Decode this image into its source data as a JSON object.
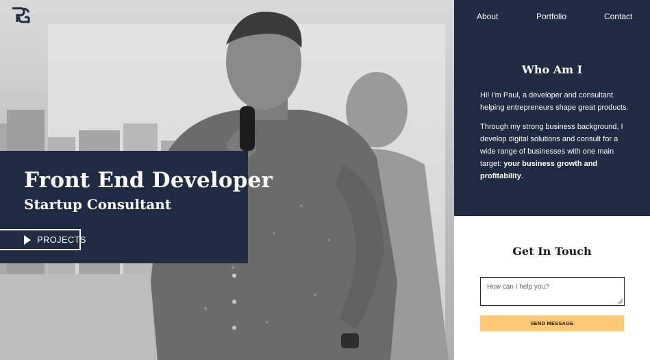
{
  "brand": {
    "logo_icon": "pg-monogram-icon"
  },
  "hero": {
    "title": "Front End Developer",
    "subtitle": "Startup Consultant",
    "projects_button": {
      "icon": "play-icon",
      "label": "PROJECTS"
    }
  },
  "nav": {
    "items": [
      {
        "label": "About"
      },
      {
        "label": "Portfolio"
      },
      {
        "label": "Contact"
      }
    ]
  },
  "about": {
    "heading": "Who Am I",
    "intro": "Hi! I'm Paul, a developer and consultant helping entrepreneurs shape great products.",
    "body_prefix": "Through my strong business background, I develop digital solutions and consult for a wide range of businesses with one main target: ",
    "body_emphasis": "your business growth and profitability",
    "body_suffix": "."
  },
  "contact": {
    "heading": "Get In Touch",
    "message_placeholder": "How can I help you?",
    "message_value": "",
    "send_label": "SEND MESSAGE"
  },
  "colors": {
    "navy": "#1f2b42",
    "accent_button": "#ffc977",
    "white": "#ffffff"
  }
}
